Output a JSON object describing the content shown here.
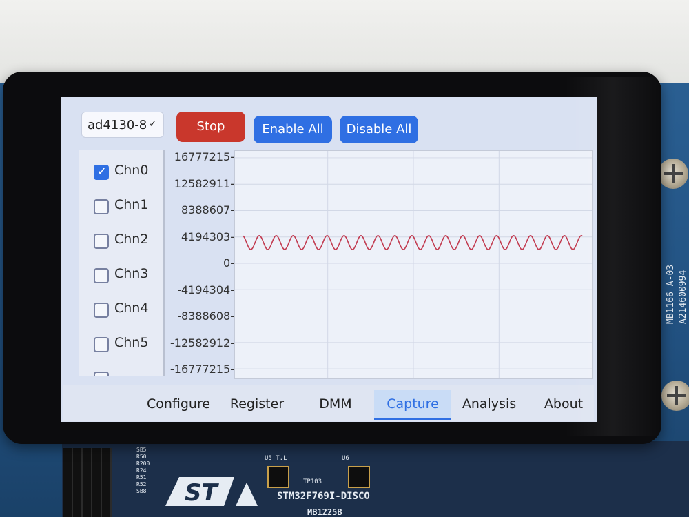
{
  "toolbar": {
    "device_select": "ad4130-8",
    "stop_label": "Stop",
    "enable_all_label": "Enable All",
    "disable_all_label": "Disable All"
  },
  "channels": [
    {
      "label": "Chn0",
      "checked": true
    },
    {
      "label": "Chn1",
      "checked": false
    },
    {
      "label": "Chn2",
      "checked": false
    },
    {
      "label": "Chn3",
      "checked": false
    },
    {
      "label": "Chn4",
      "checked": false
    },
    {
      "label": "Chn5",
      "checked": false
    }
  ],
  "chart_data": {
    "type": "line",
    "yticks": [
      "16777215-",
      "12582911-",
      "8388607-",
      "4194303-",
      "0-",
      "-4194304-",
      "-8388608-",
      "-12582912-",
      "-16777215-"
    ],
    "ylim": [
      -16777215,
      16777215
    ],
    "series": [
      {
        "color": "#c23b50",
        "center": 3300000,
        "amplitude": 1100000,
        "cycles": 20
      }
    ]
  },
  "nav": {
    "tabs": [
      "Configure",
      "Register",
      "DMM",
      "Capture",
      "Analysis",
      "About"
    ],
    "active": "Capture"
  },
  "board": {
    "name": "STM32F769I-DISCO",
    "mb": "MB1225B",
    "side_label_1": "MB1166  A-03",
    "side_label_2": "A214600994",
    "u5": "U5 T.L",
    "u6": "U6",
    "tp": "TP103",
    "silk_refs": [
      "SB5",
      "R50",
      "R200",
      "R24",
      "R51",
      "R52",
      "SB8"
    ]
  }
}
